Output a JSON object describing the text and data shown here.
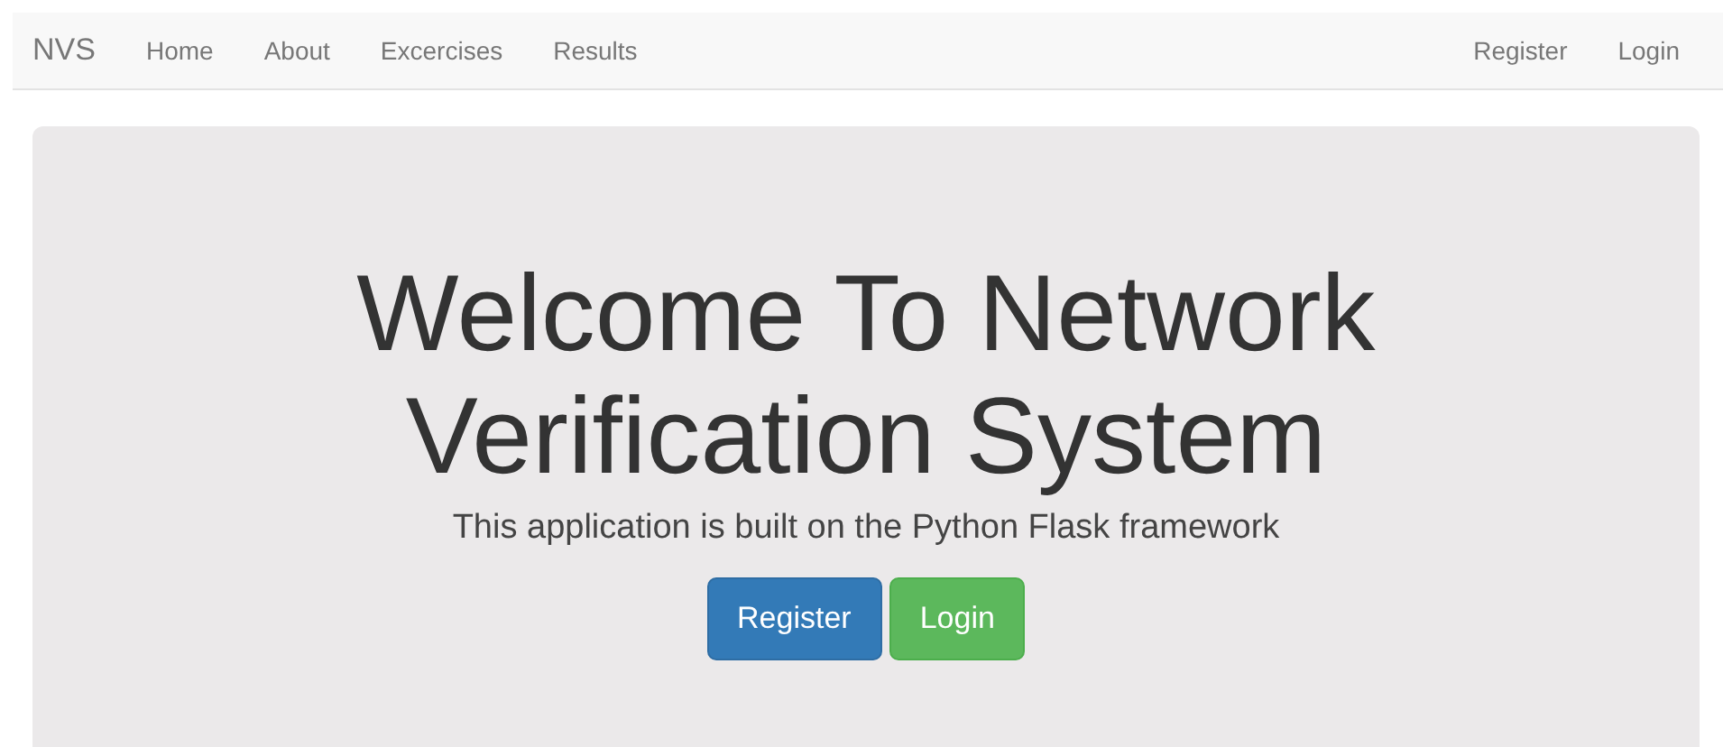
{
  "navbar": {
    "brand": "NVS",
    "left_links": [
      "Home",
      "About",
      "Excercises",
      "Results"
    ],
    "right_links": [
      "Register",
      "Login"
    ]
  },
  "hero": {
    "title_lines": [
      "Welcome To Network",
      "Verification System"
    ],
    "subtitle": "This application is built on the Python Flask framework",
    "buttons": [
      {
        "label": "Register",
        "kind": "primary"
      },
      {
        "label": "Login",
        "kind": "success"
      }
    ]
  }
}
